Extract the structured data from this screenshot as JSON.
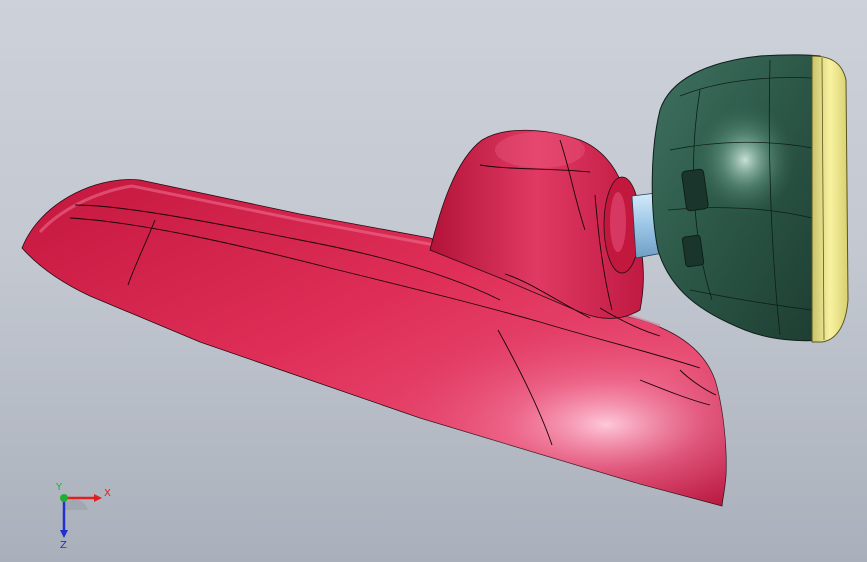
{
  "viewport": {
    "background_top": "#cdd1d9",
    "background_bottom": "#aab0bb"
  },
  "model": {
    "base_color": "#d8234f",
    "head_color": "#2f5a4a",
    "lens_rim_color": "#efe88a",
    "connector_color": "#9cc6e6"
  },
  "triad": {
    "x_label": "X",
    "y_label": "Y",
    "z_label": "Z",
    "x_color": "#e02020",
    "y_color": "#20b030",
    "z_color": "#2030d0"
  }
}
